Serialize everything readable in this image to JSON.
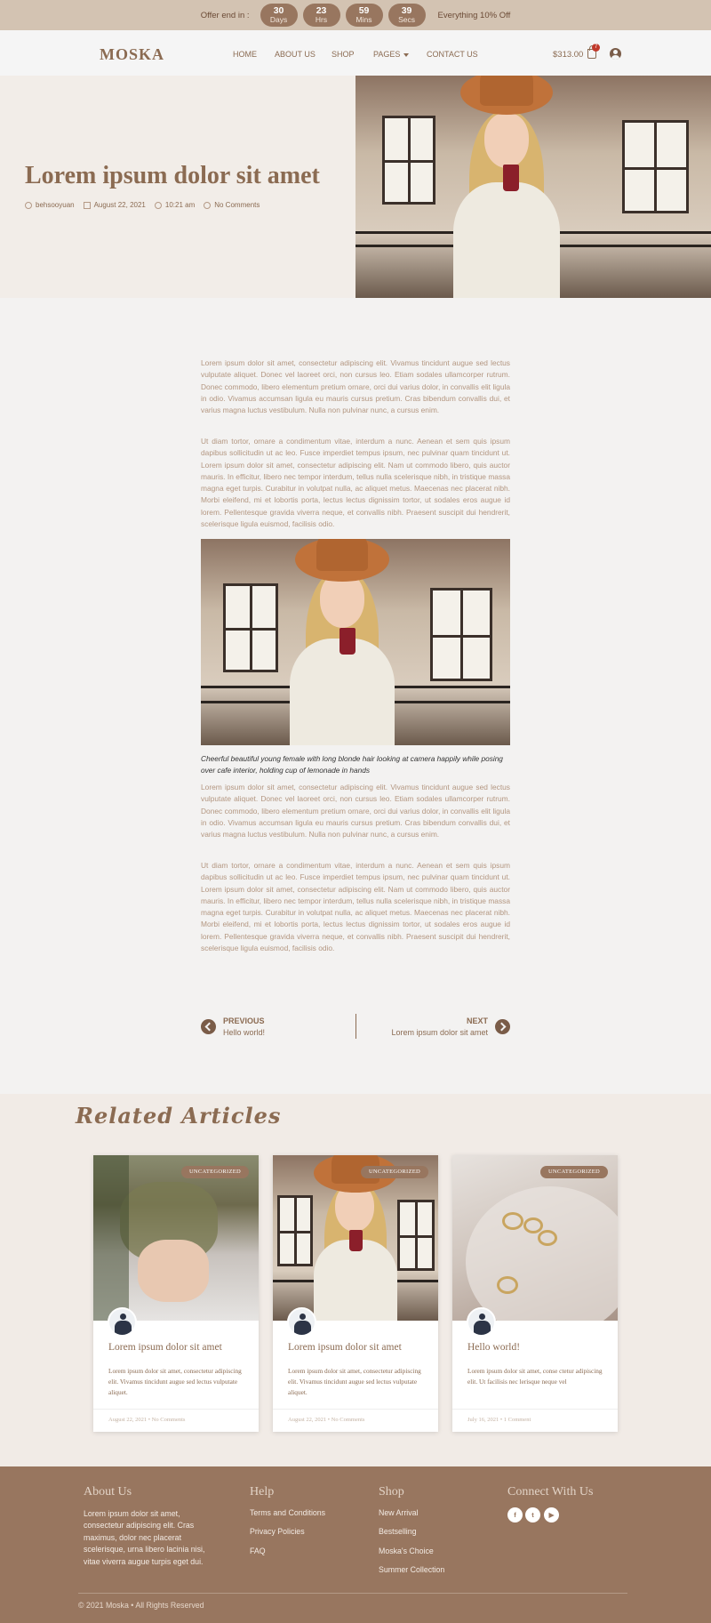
{
  "topbar": {
    "offer_label": "Offer end in :",
    "countdown": [
      {
        "value": "30",
        "unit": "Days"
      },
      {
        "value": "23",
        "unit": "Hrs"
      },
      {
        "value": "59",
        "unit": "Mins"
      },
      {
        "value": "39",
        "unit": "Secs"
      }
    ],
    "promo": "Everything 10% Off"
  },
  "header": {
    "logo": "MOSKA",
    "nav": [
      "HOME",
      "ABOUT US",
      "SHOP",
      "PAGES",
      "CONTACT US"
    ],
    "cart_total": "$313.00",
    "cart_count": "7"
  },
  "hero": {
    "title": "Lorem ipsum dolor sit amet",
    "author": "behsooyuan",
    "date": "August 22, 2021",
    "time": "10:21 am",
    "comments": "No Comments"
  },
  "article": {
    "paragraphs": [
      "Lorem ipsum dolor sit amet, consectetur adipiscing elit. Vivamus tincidunt augue sed lectus vulputate aliquet. Donec vel laoreet orci, non cursus leo. Etiam sodales ullamcorper rutrum. Donec commodo, libero elementum pretium ornare, orci dui varius dolor, in convallis elit ligula in odio. Vivamus accumsan ligula eu mauris cursus pretium. Cras bibendum convallis dui, et varius magna luctus vestibulum. Nulla non pulvinar nunc, a cursus enim.",
      "Ut diam tortor, ornare a condimentum vitae, interdum a nunc. Aenean et sem quis ipsum dapibus sollicitudin ut ac leo. Fusce imperdiet tempus ipsum, nec pulvinar quam tincidunt ut. Lorem ipsum dolor sit amet, consectetur adipiscing elit. Nam ut commodo libero, quis auctor mauris. In efficitur, libero nec tempor interdum, tellus nulla scelerisque nibh, in tristique massa magna eget turpis. Curabitur in volutpat nulla, ac aliquet metus. Maecenas nec placerat nibh. Morbi eleifend, mi et lobortis porta, lectus lectus dignissim tortor, ut sodales eros augue id lorem. Pellentesque gravida viverra neque, et convallis nibh. Praesent suscipit dui hendrerit, scelerisque ligula euismod, facilisis odio.",
      "Lorem ipsum dolor sit amet, consectetur adipiscing elit. Vivamus tincidunt augue sed lectus vulputate aliquet. Donec vel laoreet orci, non cursus leo. Etiam sodales ullamcorper rutrum. Donec commodo, libero elementum pretium ornare, orci dui varius dolor, in convallis elit ligula in odio. Vivamus accumsan ligula eu mauris cursus pretium. Cras bibendum convallis dui, et varius magna luctus vestibulum. Nulla non pulvinar nunc, a cursus enim.",
      "Ut diam tortor, ornare a condimentum vitae, interdum a nunc. Aenean et sem quis ipsum dapibus sollicitudin ut ac leo. Fusce imperdiet tempus ipsum, nec pulvinar quam tincidunt ut. Lorem ipsum dolor sit amet, consectetur adipiscing elit. Nam ut commodo libero, quis auctor mauris. In efficitur, libero nec tempor interdum, tellus nulla scelerisque nibh, in tristique massa magna eget turpis. Curabitur in volutpat nulla, ac aliquet metus. Maecenas nec placerat nibh. Morbi eleifend, mi et lobortis porta, lectus lectus dignissim tortor, ut sodales eros augue id lorem. Pellentesque gravida viverra neque, et convallis nibh. Praesent suscipit dui hendrerit, scelerisque ligula euismod, facilisis odio."
    ],
    "caption": "Cheerful beautiful young female with long blonde hair looking at camera happily while posing over cafe interior, holding cup of lemonade in hands"
  },
  "post_nav": {
    "prev_label": "PREVIOUS",
    "prev_title": "Hello world!",
    "next_label": "NEXT",
    "next_title": "Lorem ipsum dolor sit amet"
  },
  "related": {
    "heading": "Related Articles",
    "cards": [
      {
        "category": "UNCATEGORIZED",
        "title": "Lorem ipsum dolor sit amet",
        "excerpt": "Lorem ipsum dolor sit amet, consectetur adipiscing elit. Vivamus tincidunt augue sed lectus vulputate aliquet.",
        "footer": "August 22, 2021  •  No Comments"
      },
      {
        "category": "UNCATEGORIZED",
        "title": "Lorem ipsum dolor sit amet",
        "excerpt": "Lorem ipsum dolor sit amet, consectetur adipiscing elit. Vivamus tincidunt augue sed lectus vulputate aliquet.",
        "footer": "August 22, 2021  •  No Comments"
      },
      {
        "category": "UNCATEGORIZED",
        "title": "Hello world!",
        "excerpt": "Lorem ipsum dolor sit amet, conse ctetur adipiscing elit. Ut facilisis nec lerisque neque vel",
        "footer": "July 16, 2021  •  1 Comment"
      }
    ]
  },
  "footer": {
    "about_heading": "About Us",
    "about_text": "Lorem ipsum dolor sit amet, consectetur adipiscing elit. Cras maximus, dolor nec placerat scelerisque, urna libero lacinia nisi, vitae viverra augue turpis eget dui.",
    "help_heading": "Help",
    "help_links": [
      "Terms and Conditions",
      "Privacy Policies",
      "FAQ"
    ],
    "shop_heading": "Shop",
    "shop_links": [
      "New Arrival",
      "Bestselling",
      "Moska's Choice",
      "Summer Collection"
    ],
    "connect_heading": "Connect With Us",
    "social_icons": [
      "facebook-icon",
      "twitter-icon",
      "youtube-icon"
    ],
    "copyright": "© 2021 Moska • All Rights Reserved"
  },
  "colors": {
    "brand": "#8b6b52",
    "topbar_bg": "#d3c3b2",
    "accent": "#98765f",
    "footer_bg": "#98765f",
    "cart_badge": "#c0392b"
  }
}
